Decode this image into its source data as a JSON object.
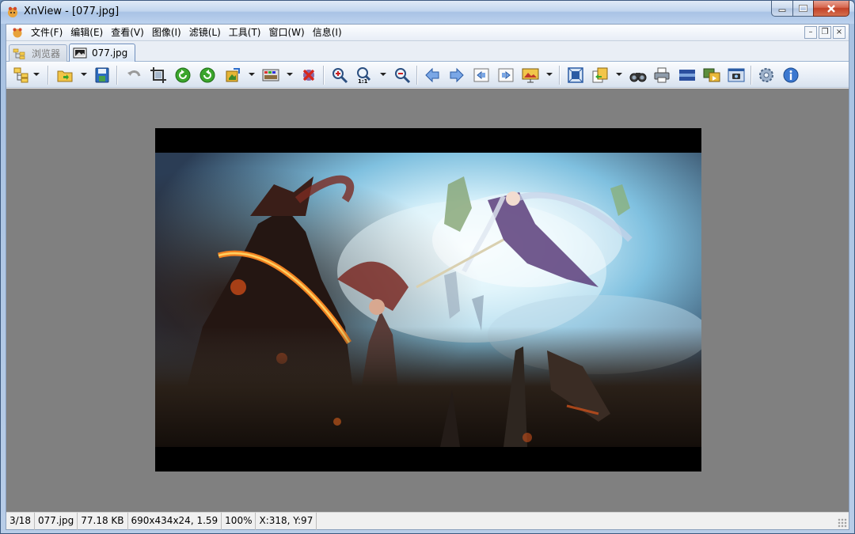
{
  "window": {
    "title": "XnView - [077.jpg]"
  },
  "menu": {
    "items": [
      "文件(F)",
      "编辑(E)",
      "查看(V)",
      "图像(I)",
      "滤镜(L)",
      "工具(T)",
      "窗口(W)",
      "信息(I)"
    ]
  },
  "mdi": {
    "minimize": "–",
    "restore": "❐",
    "close": "×"
  },
  "tabs": [
    {
      "label": "浏览器",
      "active": false,
      "icon": "browser-tree-icon"
    },
    {
      "label": "077.jpg",
      "active": true,
      "icon": "image-document-icon"
    }
  ],
  "toolbar": {
    "icons": [
      "browser-tree-icon",
      "open-folder-icon",
      "save-icon",
      "undo-icon",
      "crop-icon",
      "rotate-left-icon",
      "rotate-right-icon",
      "transform-icon",
      "adjust-colors-icon",
      "delete-icon",
      "zoom-in-icon",
      "zoom-1to1-icon",
      "zoom-out-icon",
      "previous-icon",
      "next-icon",
      "first-page-icon",
      "last-page-icon",
      "slideshow-icon",
      "fullscreen-icon",
      "convert-icon",
      "find-icon",
      "print-icon",
      "scanner-icon",
      "batch-convert-icon",
      "capture-icon",
      "settings-icon",
      "info-icon"
    ]
  },
  "image": {
    "description_icon": "fantasy-battle-artwork-image"
  },
  "status": {
    "index": "3/18",
    "filename": "077.jpg",
    "filesize": "77.18 KB",
    "dimensions": "690x434x24, 1.59",
    "zoom": "100%",
    "cursor": "X:318, Y:97"
  },
  "colors": {
    "viewer_background": "#808080",
    "title_close": "#c24127"
  }
}
